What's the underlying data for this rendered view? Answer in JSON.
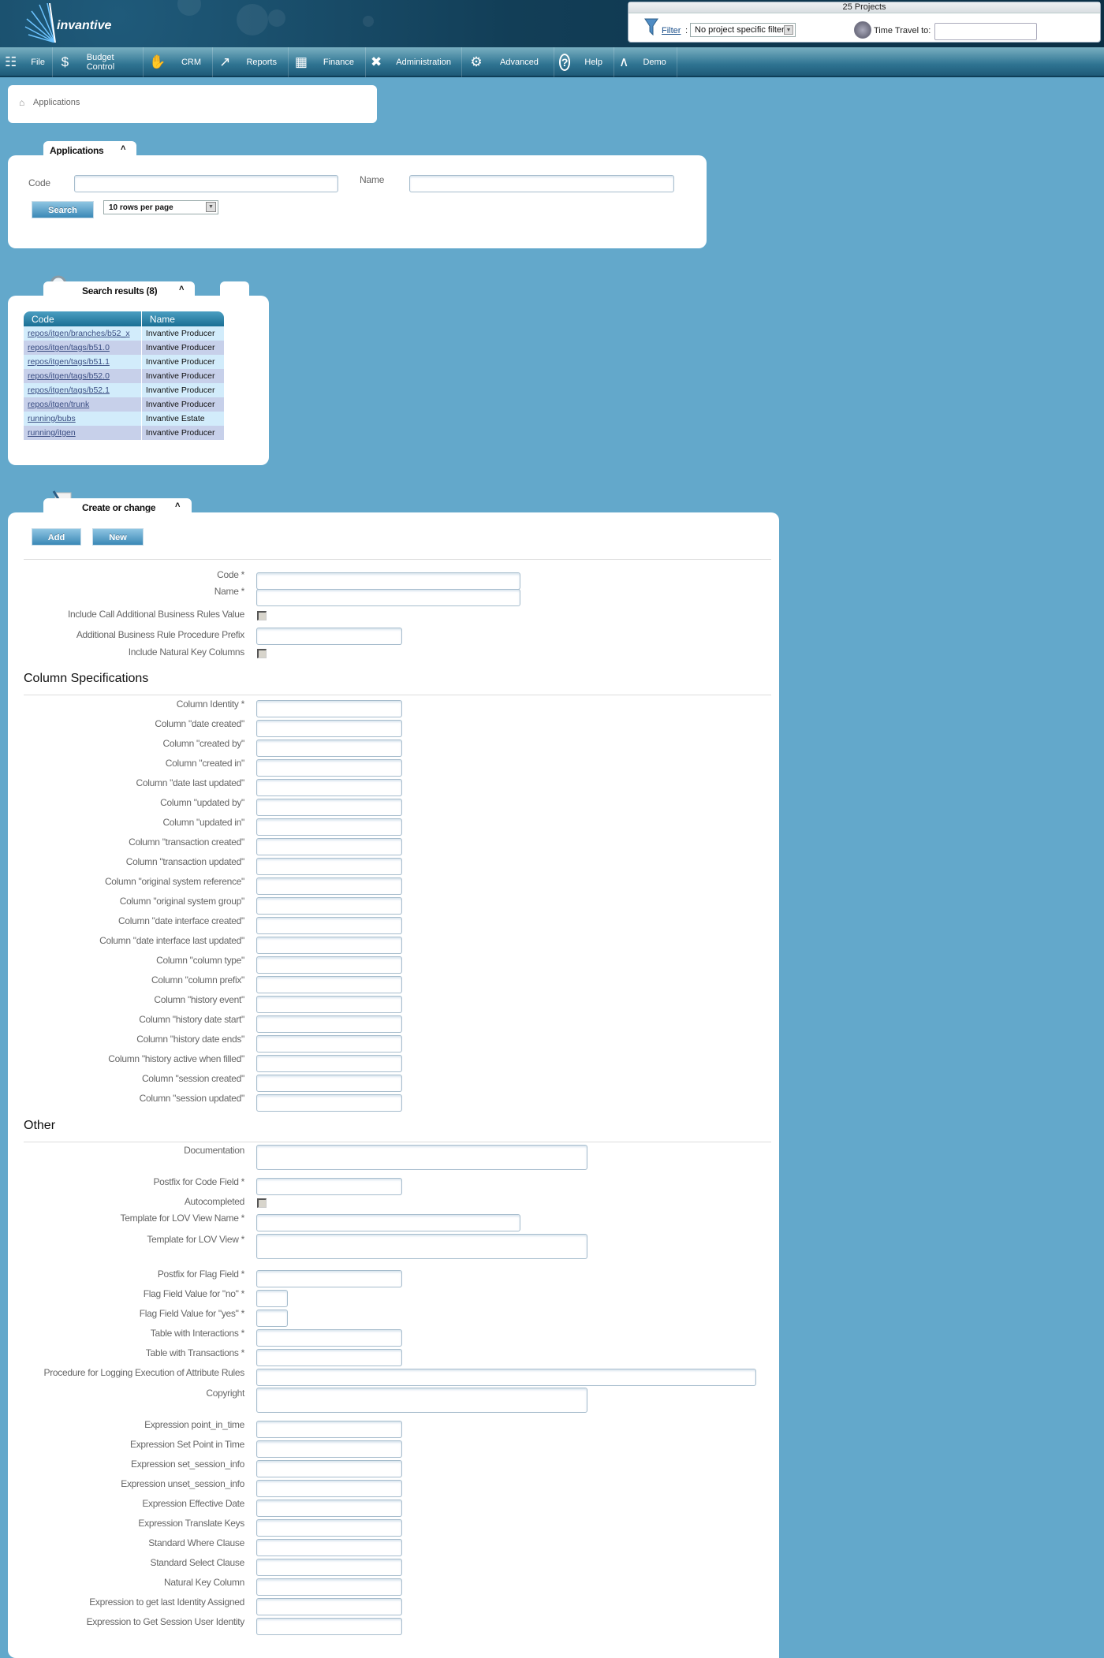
{
  "header": {
    "logo_text": "invantive",
    "projects_count_label": "25 Projects",
    "filter_link": "Filter",
    "filter_colon": ":",
    "filter_selected": "No project specific filter",
    "time_travel_label": "Time Travel to:",
    "time_travel_value": "",
    "power_icon": "⏻"
  },
  "menu": [
    {
      "label": "File",
      "icon": "file-cabinet-icon",
      "glyph": "☷"
    },
    {
      "label": "Budget Control",
      "icon": "money-bag-icon",
      "glyph": "$"
    },
    {
      "label": "CRM",
      "icon": "handshake-icon",
      "glyph": "✋"
    },
    {
      "label": "Reports",
      "icon": "presentation-chart-icon",
      "glyph": "↗"
    },
    {
      "label": "Finance",
      "icon": "calculator-icon",
      "glyph": "▦"
    },
    {
      "label": "Administration",
      "icon": "tools-icon",
      "glyph": "✖"
    },
    {
      "label": "Advanced",
      "icon": "gears-icon",
      "glyph": "⚙"
    },
    {
      "label": "Help",
      "icon": "help-icon",
      "glyph": "?"
    },
    {
      "label": "Demo",
      "icon": "invantive-demo-icon",
      "glyph": "∧"
    }
  ],
  "breadcrumb": {
    "home_icon": "⌂",
    "label": "Applications"
  },
  "search_panel": {
    "tab_title": "Applications",
    "collapse_glyph": "˄",
    "code_label": "Code",
    "code_value": "",
    "name_label": "Name",
    "name_value": "",
    "search_button": "Search",
    "rows_per_page": "10 rows per page"
  },
  "results_panel": {
    "tab_title": "Search results (8)",
    "collapse_glyph": "˄",
    "columns": [
      "Code",
      "Name"
    ],
    "rows": [
      {
        "code": "repos/itgen/branches/b52_x",
        "name": "Invantive Producer"
      },
      {
        "code": "repos/itgen/tags/b51.0",
        "name": "Invantive Producer"
      },
      {
        "code": "repos/itgen/tags/b51.1",
        "name": "Invantive Producer"
      },
      {
        "code": "repos/itgen/tags/b52.0",
        "name": "Invantive Producer"
      },
      {
        "code": "repos/itgen/tags/b52.1",
        "name": "Invantive Producer"
      },
      {
        "code": "repos/itgen/trunk",
        "name": "Invantive Producer"
      },
      {
        "code": "running/bubs",
        "name": "Invantive Estate"
      },
      {
        "code": "running/itgen",
        "name": "Invantive Producer"
      }
    ]
  },
  "form_panel": {
    "tab_title": "Create or change",
    "collapse_glyph": "˄",
    "add_button": "Add",
    "new_button": "New",
    "general_fields": [
      {
        "label": "Code *",
        "type": "text",
        "size": "large",
        "value": ""
      },
      {
        "label": "Name *",
        "type": "text",
        "size": "large",
        "value": ""
      },
      {
        "label": "Include Call Additional Business Rules Value",
        "type": "checkbox",
        "checked": false
      },
      {
        "label": "Additional Business Rule Procedure Prefix",
        "type": "text",
        "size": "medium",
        "value": ""
      },
      {
        "label": "Include Natural Key Columns",
        "type": "checkbox",
        "checked": false
      }
    ],
    "column_specs_heading": "Column Specifications",
    "column_fields": [
      "Column Identity *",
      "Column \"date created\"",
      "Column \"created by\"",
      "Column \"created in\"",
      "Column \"date last updated\"",
      "Column \"updated by\"",
      "Column \"updated in\"",
      "Column \"transaction created\"",
      "Column \"transaction updated\"",
      "Column \"original system reference\"",
      "Column \"original system group\"",
      "Column \"date interface created\"",
      "Column \"date interface last updated\"",
      "Column \"column type\"",
      "Column \"column prefix\"",
      "Column \"history event\"",
      "Column \"history date start\"",
      "Column \"history date ends\"",
      "Column \"history active when filled\"",
      "Column \"session created\"",
      "Column \"session updated\""
    ],
    "other_heading": "Other",
    "other_fields": [
      {
        "label": "Documentation",
        "type": "textarea"
      },
      {
        "label": "Postfix for Code Field *",
        "type": "text"
      },
      {
        "label": "Autocompleted",
        "type": "checkbox",
        "checked": false
      },
      {
        "label": "Template for LOV View Name *",
        "type": "text"
      },
      {
        "label": "Template for LOV View *",
        "type": "textarea"
      },
      {
        "label": "Postfix for Flag Field *",
        "type": "text"
      },
      {
        "label": "Flag Field Value for \"no\" *",
        "type": "text"
      },
      {
        "label": "Flag Field Value for \"yes\" *",
        "type": "text"
      },
      {
        "label": "Table with Interactions *",
        "type": "text"
      },
      {
        "label": "Table with Transactions *",
        "type": "text"
      },
      {
        "label": "Procedure for Logging Execution of Attribute Rules",
        "type": "text"
      },
      {
        "label": "Copyright",
        "type": "textarea"
      },
      {
        "label": "Expression point_in_time",
        "type": "text"
      },
      {
        "label": "Expression Set Point in Time",
        "type": "text"
      },
      {
        "label": "Expression set_session_info",
        "type": "text"
      },
      {
        "label": "Expression unset_session_info",
        "type": "text"
      },
      {
        "label": "Expression Effective Date",
        "type": "text"
      },
      {
        "label": "Expression Translate Keys",
        "type": "text"
      },
      {
        "label": "Standard Where Clause",
        "type": "text"
      },
      {
        "label": "Standard Select Clause",
        "type": "text"
      },
      {
        "label": "Natural Key Column",
        "type": "text"
      },
      {
        "label": "Expression to get last Identity Assigned",
        "type": "text"
      },
      {
        "label": "Expression to Get Session User Identity",
        "type": "text"
      }
    ]
  },
  "colors": {
    "page_background": "#63a8cb",
    "header_dark": "#0b2f45",
    "button_blue": "#3a88b6",
    "table_header": "#1a6f94",
    "row_odd": "#d2ecfb",
    "row_even": "#c7d0ea"
  }
}
